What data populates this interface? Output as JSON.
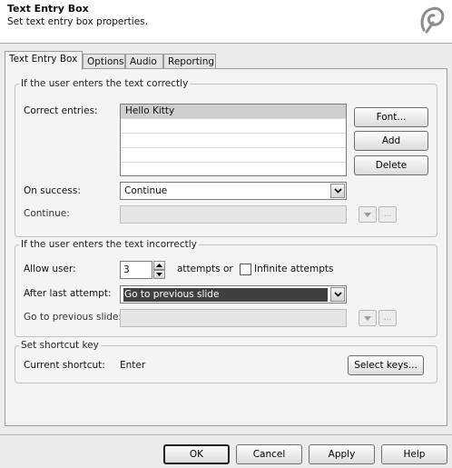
{
  "header": {
    "title": "Text Entry Box",
    "subtitle": "Set text entry box properties.",
    "logo_icon": "swirl-logo-icon"
  },
  "tabs": [
    {
      "label": "Text Entry Box",
      "active": true
    },
    {
      "label": "Options",
      "active": false
    },
    {
      "label": "Audio",
      "active": false
    },
    {
      "label": "Reporting",
      "active": false
    }
  ],
  "correct_group": {
    "legend": "If the user enters the text correctly",
    "correct_entries_label": "Correct entries:",
    "entries": [
      "Hello Kitty",
      "",
      "",
      "",
      ""
    ],
    "font_button": "Font...",
    "add_button": "Add",
    "delete_button": "Delete",
    "on_success_label": "On success:",
    "on_success_value": "Continue",
    "continue_label": "Continue:",
    "continue_value": "",
    "continue_down_icon": "triangle-down-icon",
    "continue_browse": "..."
  },
  "incorrect_group": {
    "legend": "If the user enters the text incorrectly",
    "allow_user_label": "Allow user:",
    "attempts_value": "3",
    "attempts_suffix": "attempts or",
    "infinite_label": "Infinite attempts",
    "infinite_checked": false,
    "after_last_label": "After last attempt:",
    "after_last_value": "Go to previous slide",
    "goto_prev_label": "Go to previous slide:",
    "goto_prev_value": "",
    "goto_down_icon": "triangle-down-icon",
    "goto_browse": "..."
  },
  "shortcut_group": {
    "legend": "Set shortcut key",
    "current_label": "Current shortcut:",
    "current_value": "Enter",
    "select_keys_button": "Select keys..."
  },
  "footer": {
    "ok": "OK",
    "cancel": "Cancel",
    "apply": "Apply",
    "help": "Help"
  }
}
